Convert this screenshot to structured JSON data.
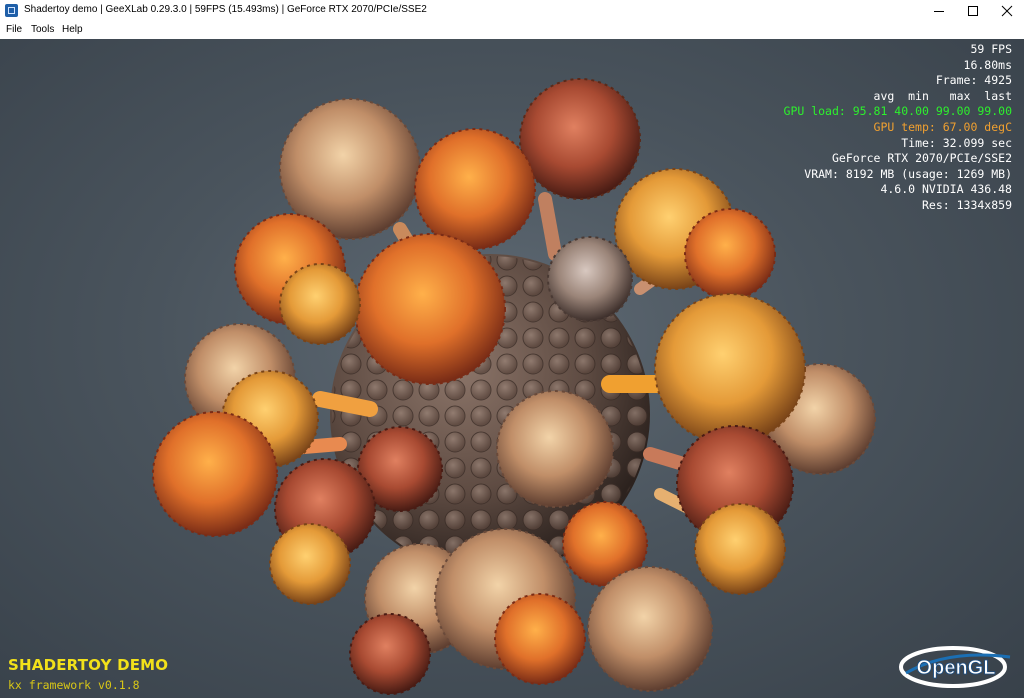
{
  "window": {
    "title": "Shadertoy demo | GeeXLab 0.29.3.0 | 59FPS (15.493ms) | GeForce RTX 2070/PCIe/SSE2",
    "controls": {
      "minimize": "minimize-icon",
      "maximize": "maximize-icon",
      "close": "close-icon"
    }
  },
  "menu": {
    "file": "File",
    "tools": "Tools",
    "help": "Help"
  },
  "hud": {
    "fps": "59 FPS",
    "ms": "16.80ms",
    "frame": "Frame: 4925",
    "stats_header": "avg  min   max  last",
    "gpu_load": "GPU load: 95.81 40.00 99.00 99.00",
    "gpu_temp": "GPU temp: 67.00 degC",
    "time": "Time: 32.099 sec",
    "gpu": "GeForce RTX 2070/PCIe/SSE2",
    "vram": "VRAM: 8192 MB (usage: 1269 MB)",
    "driver": "4.6.0 NVIDIA 436.48",
    "res": "Res: 1334x859",
    "gpu_load_color": "#2df02d",
    "gpu_temp_color": "#f0a030"
  },
  "demo": {
    "title": "SHADERTOY DEMO",
    "subtitle": "kx framework v0.1.8",
    "title_color": "#f2e11a"
  },
  "logo": {
    "text": "OpenGL",
    "icon": "opengl-logo"
  }
}
